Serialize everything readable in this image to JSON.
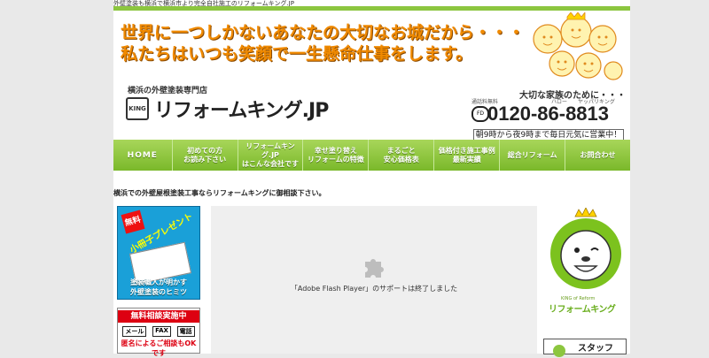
{
  "top_text": "外壁塗装も横浜で横浜市より完全自社施工のリフォームキング.JP",
  "header": {
    "slogan_line1": "世界に一つしかないあなたの大切なお城だから・・・",
    "slogan_line2": "私たちはいつも笑顔で一生懸命仕事をします。",
    "tagline": "横浜の外壁塗装専門店",
    "logo_mark": "KING",
    "logo_text": "リフォームキング.JP",
    "family_text": "大切な家族のために・・・",
    "phone_note_left": "通話料無料",
    "phone_reading1": "ハロー",
    "phone_reading2": "ヤッパリキング",
    "freedial": "FD",
    "phone_number": "0120-86-8813",
    "hours": "朝9時から夜9時まで毎日元気に営業中！"
  },
  "nav": {
    "items": [
      {
        "label": "HOME"
      },
      {
        "label1": "初めての方",
        "label2": "お読み下さい"
      },
      {
        "label1": "リフォームキング.JP",
        "label2": "はこんな会社です"
      },
      {
        "label1": "幸せ塗り替え",
        "label2": "リフォームの特徴"
      },
      {
        "label1": "まるごと",
        "label2": "安心価格表"
      },
      {
        "label1": "価格付き施工事例",
        "label2": "最新実績"
      },
      {
        "label": "総合リフォーム"
      },
      {
        "label": "お問合わせ"
      }
    ]
  },
  "intro": "横浜での外壁屋根塗装工事ならリフォームキングに御相談下さい。",
  "left_banners": {
    "booklet_badge": "無料",
    "booklet_title": "小冊子プレゼント",
    "booklet_bottom1": "塗装職人が明かす",
    "booklet_bottom2": "外壁塗装のヒミツ",
    "consult_title": "無料相談実施中",
    "consult_tags": [
      "メール",
      "FAX",
      "電話"
    ],
    "consult_note": "匿名によるご相談もOKです"
  },
  "flash": {
    "message": "「Adobe Flash Player」のサポートは終了しました"
  },
  "right_col": {
    "king_small": "KING of Reform",
    "brand_small": "リフォームキング",
    "staff_label": "スタッフ"
  }
}
